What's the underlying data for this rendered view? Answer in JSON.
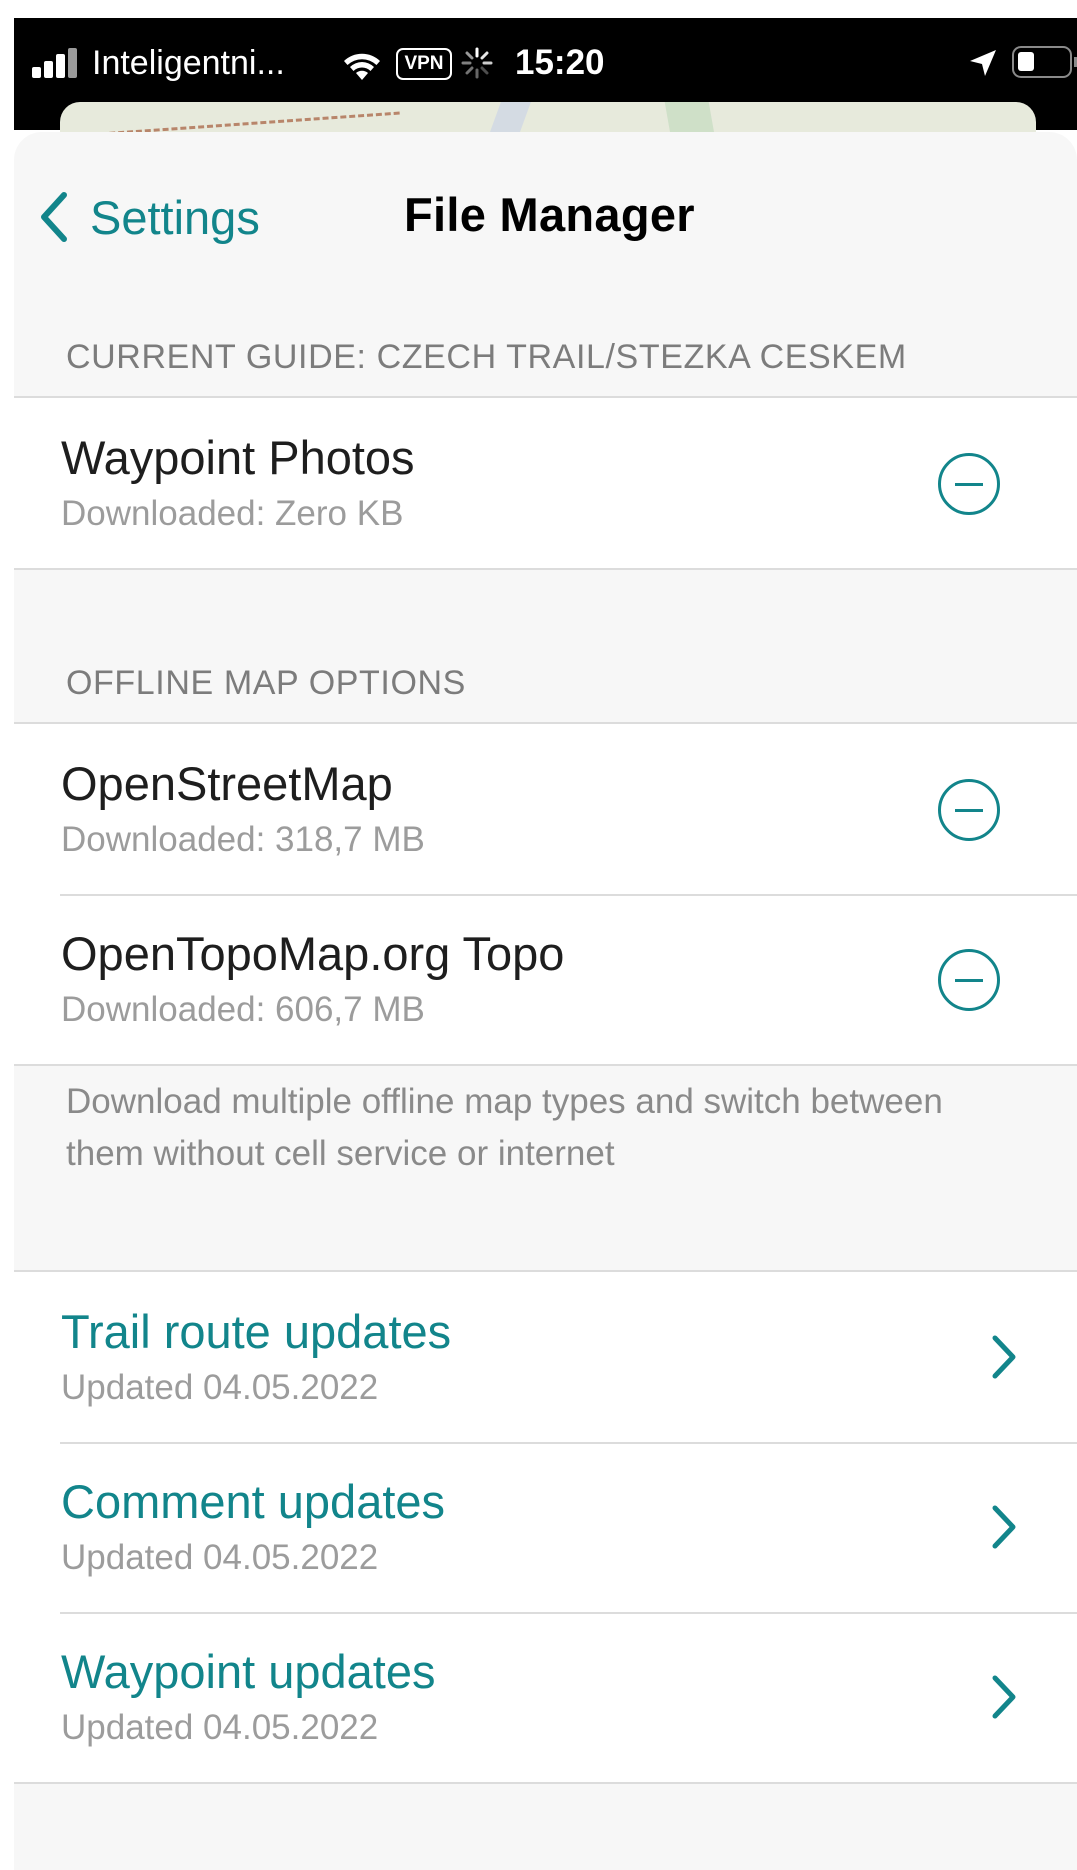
{
  "status_bar": {
    "carrier": "Inteligentni...",
    "vpn": "VPN",
    "time": "15:20"
  },
  "nav": {
    "back_label": "Settings",
    "title": "File Manager"
  },
  "current_guide": {
    "header": "CURRENT GUIDE: CZECH TRAIL/STEZKA CESKEM",
    "items": [
      {
        "title": "Waypoint Photos",
        "subtitle": "Downloaded: Zero KB"
      }
    ]
  },
  "offline_maps": {
    "header": "OFFLINE MAP OPTIONS",
    "items": [
      {
        "title": "OpenStreetMap",
        "subtitle": "Downloaded: 318,7 MB"
      },
      {
        "title": "OpenTopoMap.org Topo",
        "subtitle": "Downloaded: 606,7 MB"
      }
    ],
    "footer": "Download multiple offline map types and switch between them without cell service or internet"
  },
  "updates": {
    "items": [
      {
        "title": "Trail route updates",
        "subtitle": "Updated 04.05.2022"
      },
      {
        "title": "Comment updates",
        "subtitle": "Updated 04.05.2022"
      },
      {
        "title": "Waypoint updates",
        "subtitle": "Updated 04.05.2022"
      }
    ]
  },
  "colors": {
    "accent": "#12858b",
    "background": "#f7f7f7",
    "secondary_text": "#9c9c9c"
  },
  "icons": {
    "back": "chevron-left-icon",
    "delete": "minus-circle-icon",
    "disclosure": "chevron-right-icon"
  }
}
